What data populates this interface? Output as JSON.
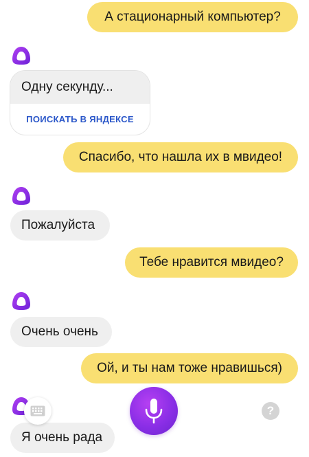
{
  "messages": {
    "m1": "А стационарный компьютер?",
    "m2": "Одну секунду...",
    "m2_action": "ПОИСКАТЬ В ЯНДЕКСЕ",
    "m3": "Спасибо, что нашла их в мвидео!",
    "m4": "Пожалуйста",
    "m5": "Тебе нравится мвидео?",
    "m6": "Очень очень",
    "m7": "Ой, и ты нам тоже нравишься)",
    "m8": "Я очень рада"
  },
  "controls": {
    "keyboard_icon": "keyboard-icon",
    "mic_icon": "microphone-icon",
    "help_label": "?"
  },
  "colors": {
    "user_bubble": "#f9df72",
    "bot_bubble": "#efefef",
    "alice_purple": "#8a2ee6",
    "link_blue": "#2b57c9"
  }
}
